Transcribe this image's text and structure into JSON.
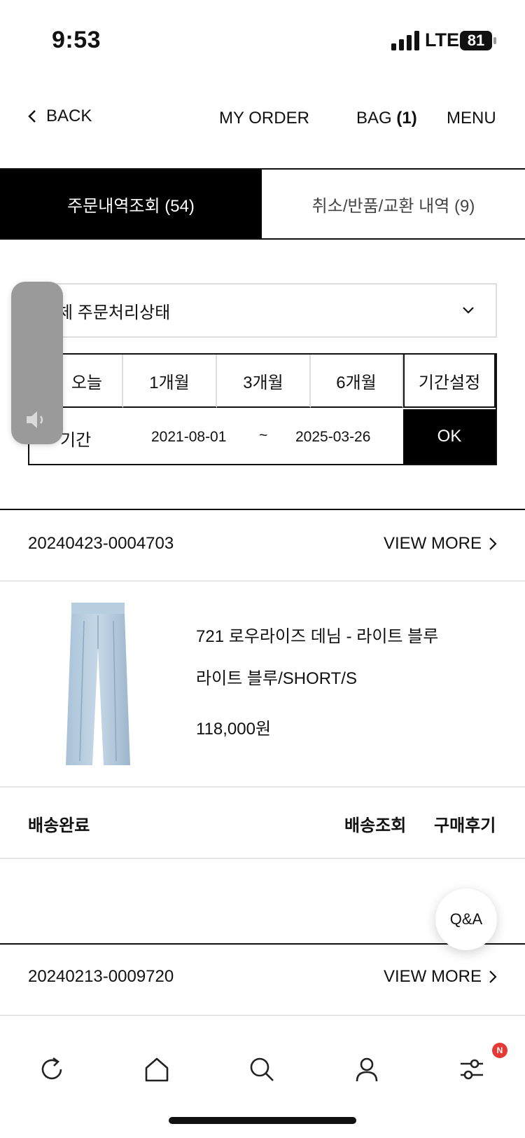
{
  "status_bar": {
    "time": "9:53",
    "network": "LTE",
    "battery": "81"
  },
  "top_nav": {
    "back_label": "BACK",
    "my_order": "MY ORDER",
    "bag_label": "BAG ",
    "bag_count": "(1)",
    "menu": "MENU"
  },
  "tabs": [
    {
      "label": "주문내역조회 (54)"
    },
    {
      "label": "취소/반품/교환 내역 (9)"
    }
  ],
  "filter": {
    "status_select": "전체 주문처리상태",
    "status_select_visible": "체 주문처리상태"
  },
  "period": {
    "options": [
      "오늘",
      "1개월",
      "3개월",
      "6개월",
      "기간설정"
    ],
    "range_label": "기간",
    "start_date": "2021-08-01",
    "separator": "~",
    "end_date": "2025-03-26",
    "ok_label": "OK"
  },
  "orders": [
    {
      "order_number": "20240423-0004703",
      "view_more": "VIEW MORE",
      "product_name": "721 로우라이즈 데님 - 라이트 블루",
      "option": "라이트 블루/SHORT/S",
      "price": "118,000원",
      "status": "배송완료",
      "track_label": "배송조회",
      "review_label": "구매후기"
    },
    {
      "order_number": "20240213-0009720",
      "view_more": "VIEW MORE"
    }
  ],
  "qa_button": "Q&A",
  "bottom_nav": {
    "icons": [
      "refresh-icon",
      "home-icon",
      "search-icon",
      "user-icon",
      "filter-icon"
    ],
    "badge": "N"
  },
  "colors": {
    "active_tab": "#000000",
    "badge": "#e53935",
    "divider": "#e5e5e5"
  }
}
